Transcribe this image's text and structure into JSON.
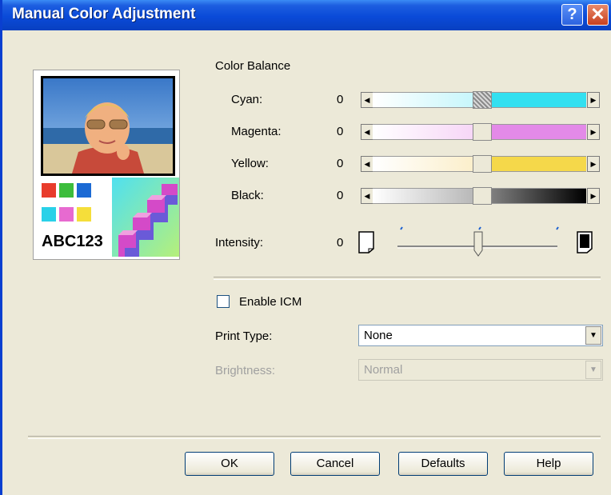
{
  "window": {
    "title": "Manual Color Adjustment"
  },
  "preview": {
    "sample_text": "ABC123"
  },
  "color_balance": {
    "heading": "Color Balance",
    "sliders": [
      {
        "label": "Cyan:",
        "value": "0",
        "color": "#33e0f0"
      },
      {
        "label": "Magenta:",
        "value": "0",
        "color": "#e38ae8"
      },
      {
        "label": "Yellow:",
        "value": "0",
        "color": "#f5d84a"
      },
      {
        "label": "Black:",
        "value": "0",
        "color": "#000000"
      }
    ]
  },
  "intensity": {
    "label": "Intensity:",
    "value": "0"
  },
  "icm": {
    "label": "Enable ICM",
    "checked": false
  },
  "print_type": {
    "label": "Print Type:",
    "selected": "None"
  },
  "brightness": {
    "label": "Brightness:",
    "selected": "Normal",
    "disabled": true
  },
  "buttons": {
    "ok": "OK",
    "cancel": "Cancel",
    "defaults": "Defaults",
    "help": "Help"
  },
  "icons": [
    "help-icon",
    "close-icon",
    "arrow-left-icon",
    "arrow-right-icon",
    "light-page-icon",
    "dark-page-icon",
    "dropdown-arrow-icon"
  ]
}
